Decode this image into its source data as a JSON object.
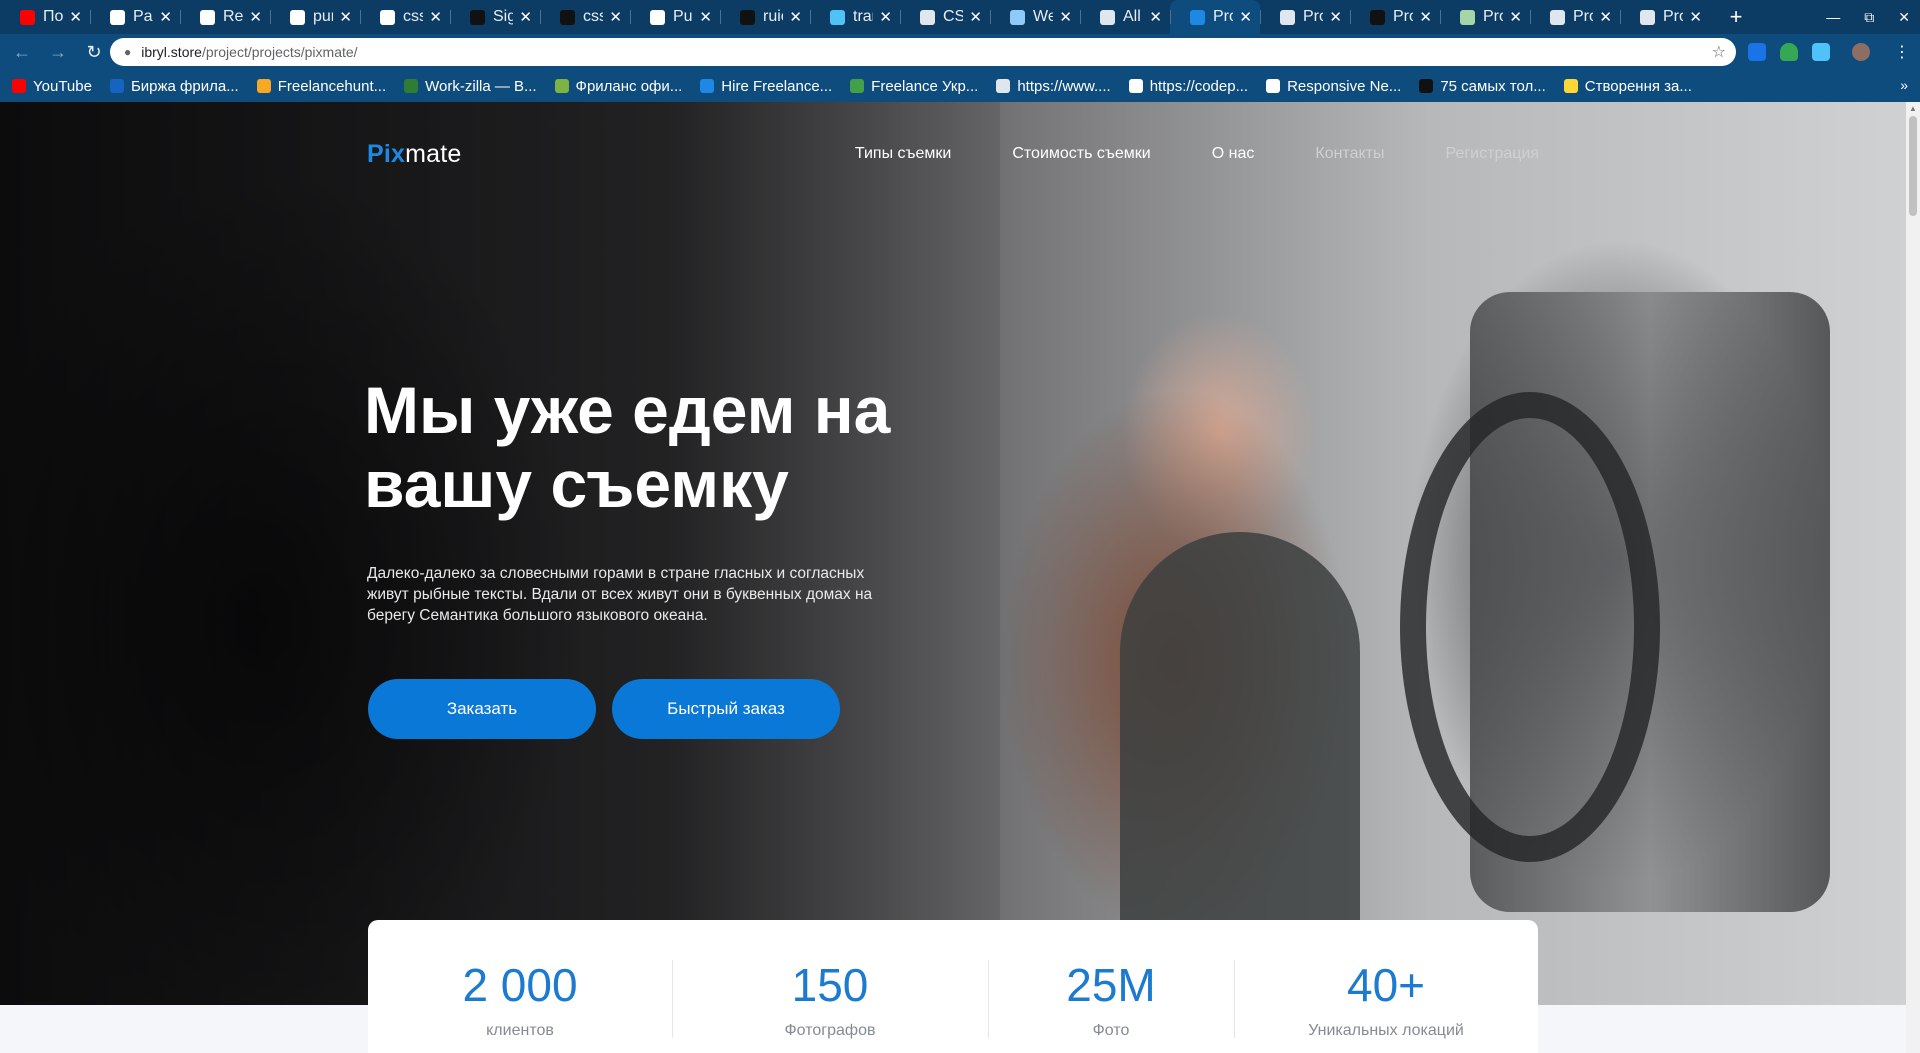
{
  "browser": {
    "tabs": [
      {
        "title": "Под",
        "icon": "youtube-icon",
        "color": "#ff0000",
        "active": false
      },
      {
        "title": "Para",
        "icon": "codepen-icon",
        "color": "#ffffff",
        "active": false
      },
      {
        "title": "Resp",
        "icon": "codepen-icon",
        "color": "#ffffff",
        "active": false
      },
      {
        "title": "pur",
        "icon": "google-icon",
        "color": "#ffffff",
        "active": false
      },
      {
        "title": "css",
        "icon": "google-icon",
        "color": "#ffffff",
        "active": false
      },
      {
        "title": "Sigr",
        "icon": "github-icon",
        "color": "#111111",
        "active": false
      },
      {
        "title": "css-",
        "icon": "github-icon",
        "color": "#111111",
        "active": false
      },
      {
        "title": "Pur",
        "icon": "codepen-icon",
        "color": "#ffffff",
        "active": false
      },
      {
        "title": "ruic",
        "icon": "github-icon",
        "color": "#111111",
        "active": false
      },
      {
        "title": "tran",
        "icon": "translate-icon",
        "color": "#4fc3f7",
        "active": false
      },
      {
        "title": "CSS",
        "icon": "globe-icon",
        "color": "#dfe6ee",
        "active": false
      },
      {
        "title": "Wel",
        "icon": "hexagon-icon",
        "color": "#90caf9",
        "active": false
      },
      {
        "title": "All F",
        "icon": "globe-icon",
        "color": "#dfe6ee",
        "active": false
      },
      {
        "title": "Proj",
        "icon": "pixmate-icon",
        "color": "#1e88e5",
        "active": true
      },
      {
        "title": "Proj",
        "icon": "globe-icon",
        "color": "#dfe6ee",
        "active": false
      },
      {
        "title": "Proj",
        "icon": "bird-icon",
        "color": "#111111",
        "active": false
      },
      {
        "title": "Proj",
        "icon": "image-icon",
        "color": "#a5d6a7",
        "active": false
      },
      {
        "title": "Proj",
        "icon": "globe-icon",
        "color": "#dfe6ee",
        "active": false
      },
      {
        "title": "Proj",
        "icon": "globe-icon",
        "color": "#dfe6ee",
        "active": false
      }
    ],
    "url": {
      "host": "ibryl.store",
      "path": "/project/projects/pixmate/"
    },
    "bookmarks": [
      {
        "label": "YouTube",
        "color": "#ff0000"
      },
      {
        "label": "Биржа фрила...",
        "color": "#1565c0"
      },
      {
        "label": "Freelancehunt...",
        "color": "#f9a825"
      },
      {
        "label": "Work-zilla — B...",
        "color": "#2e7d32"
      },
      {
        "label": "Фриланс офи...",
        "color": "#7cb342"
      },
      {
        "label": "Hire Freelance...",
        "color": "#1e88e5"
      },
      {
        "label": "Freelance Укр...",
        "color": "#43a047"
      },
      {
        "label": "https://www....",
        "color": "#dfe6ee"
      },
      {
        "label": "https://codep...",
        "color": "#ffffff"
      },
      {
        "label": "Responsive Ne...",
        "color": "#ffffff"
      },
      {
        "label": "75 самых тол...",
        "color": "#111111"
      },
      {
        "label": "Створення за...",
        "color": "#fdd835"
      }
    ]
  },
  "site": {
    "logo": {
      "accent": "Pix",
      "rest": "mate"
    },
    "nav": [
      {
        "label": "Типы съемки"
      },
      {
        "label": "Стоимость съемки"
      },
      {
        "label": "О нас"
      },
      {
        "label": "Контакты"
      },
      {
        "label": "Регистрация"
      }
    ],
    "hero": {
      "title": "Мы уже едем на вашу съемку",
      "text": "Далеко-далеко за словесными горами в стране гласных и согласных живут рыбные тексты. Вдали от всех живут они в буквенных домах на берегу Семантика большого языкового океана.",
      "order_button": "Заказать",
      "quick_order_button": "Быстрый заказ"
    },
    "stats": [
      {
        "value": "2 000",
        "label": "клиентов"
      },
      {
        "value": "150",
        "label": "Фотографов"
      },
      {
        "value": "25M",
        "label": "Фото"
      },
      {
        "value": "40+",
        "label": "Уникальных локаций"
      }
    ],
    "colors": {
      "accent": "#1e88e5",
      "button": "#0a78d6"
    }
  }
}
